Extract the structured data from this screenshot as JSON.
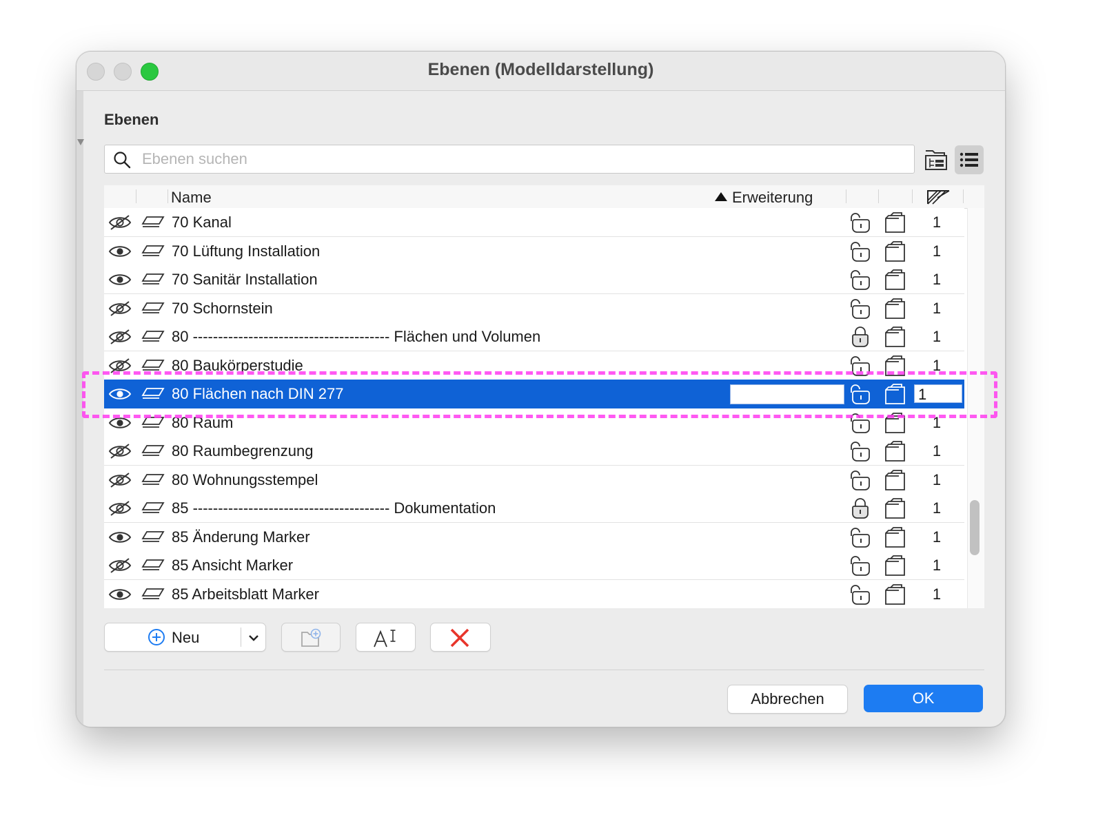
{
  "window": {
    "title": "Ebenen (Modelldarstellung)"
  },
  "section": {
    "title": "Ebenen"
  },
  "search": {
    "placeholder": "Ebenen suchen",
    "value": ""
  },
  "columns": {
    "name": "Name",
    "extension": "Erweiterung"
  },
  "rows": [
    {
      "name": "70 Kanal",
      "visible": false,
      "locked": false,
      "num": "1"
    },
    {
      "name": "70 Lüftung Installation",
      "visible": true,
      "locked": false,
      "num": "1"
    },
    {
      "name": "70 Sanitär Installation",
      "visible": true,
      "locked": false,
      "num": "1"
    },
    {
      "name": "70 Schornstein",
      "visible": false,
      "locked": false,
      "num": "1"
    },
    {
      "name": "80 --------------------------------------- Flächen und Volumen",
      "visible": false,
      "locked": true,
      "num": "1"
    },
    {
      "name": "80 Baukörperstudie",
      "visible": false,
      "locked": false,
      "num": "1"
    },
    {
      "name": "80 Flächen nach DIN 277",
      "visible": true,
      "locked": false,
      "num": "1",
      "selected": true
    },
    {
      "name": "80 Raum",
      "visible": true,
      "locked": false,
      "num": "1"
    },
    {
      "name": "80 Raumbegrenzung",
      "visible": false,
      "locked": false,
      "num": "1"
    },
    {
      "name": "80 Wohnungsstempel",
      "visible": false,
      "locked": false,
      "num": "1"
    },
    {
      "name": "85 --------------------------------------- Dokumentation",
      "visible": false,
      "locked": true,
      "num": "1"
    },
    {
      "name": "85 Änderung Marker",
      "visible": true,
      "locked": false,
      "num": "1"
    },
    {
      "name": "85 Ansicht Marker",
      "visible": false,
      "locked": false,
      "num": "1"
    },
    {
      "name": "85 Arbeitsblatt Marker",
      "visible": true,
      "locked": false,
      "num": "1"
    }
  ],
  "buttons": {
    "new": "Neu",
    "cancel": "Abbrechen",
    "ok": "OK"
  },
  "colors": {
    "selection": "#0f62d6",
    "accent": "#1d7cf2",
    "highlight": "#ff3df0",
    "delete": "#e8352b"
  }
}
